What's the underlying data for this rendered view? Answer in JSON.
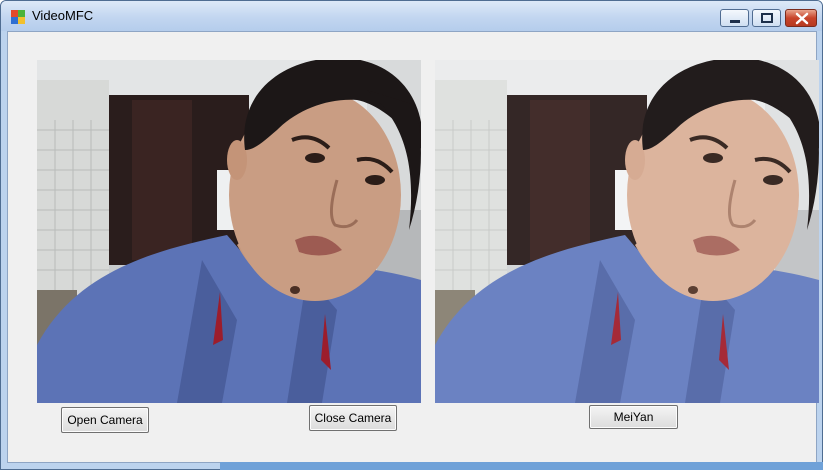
{
  "window": {
    "title": "VideoMFC",
    "icon": "app-icon",
    "controls": [
      "minimize-icon",
      "maximize-icon",
      "close-icon"
    ]
  },
  "views": {
    "original": {
      "content": "camera-frame"
    },
    "processed": {
      "content": "camera-frame-smoothed"
    }
  },
  "buttons": {
    "open_camera": "Open Camera",
    "close_camera": "Close Camera",
    "meiyan": "MeiYan"
  },
  "colors": {
    "accent": "#6fa1d8",
    "client_bg": "#f0f0f0",
    "close_button": "#c8442b"
  }
}
